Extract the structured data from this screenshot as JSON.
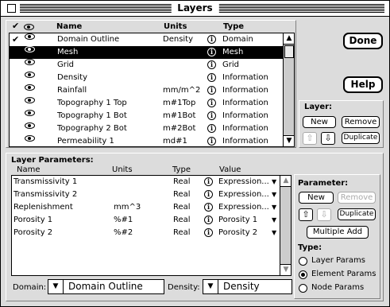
{
  "window": {
    "title": "Layers"
  },
  "layer_list": {
    "columns": {
      "check": "✔",
      "name": "Name",
      "units": "Units",
      "type": "Type"
    },
    "rows": [
      {
        "checked": true,
        "name": "Domain Outline",
        "units": "Density",
        "type": "Domain",
        "selected": false
      },
      {
        "checked": false,
        "name": "Mesh",
        "units": "",
        "type": "Mesh",
        "selected": true
      },
      {
        "checked": false,
        "name": "Grid",
        "units": "",
        "type": "Grid",
        "selected": false
      },
      {
        "checked": false,
        "name": "Density",
        "units": "",
        "type": "Information",
        "selected": false
      },
      {
        "checked": false,
        "name": "Rainfall",
        "units": "mm/m^2",
        "type": "Information",
        "selected": false
      },
      {
        "checked": false,
        "name": "Topography 1 Top",
        "units": "m#1Top",
        "type": "Information",
        "selected": false
      },
      {
        "checked": false,
        "name": "Topography 1 Bot",
        "units": "m#1Bot",
        "type": "Information",
        "selected": false
      },
      {
        "checked": false,
        "name": "Topography 2 Bot",
        "units": "m#2Bot",
        "type": "Information",
        "selected": false
      },
      {
        "checked": false,
        "name": "Permeability 1",
        "units": "md#1",
        "type": "Information",
        "selected": false
      }
    ]
  },
  "buttons": {
    "done": "Done",
    "help": "Help"
  },
  "layer_box": {
    "title": "Layer:",
    "new": "New",
    "remove": "Remove",
    "duplicate": "Duplicate"
  },
  "params": {
    "title": "Layer Parameters:",
    "columns": {
      "name": "Name",
      "units": "Units",
      "type": "Type",
      "value": "Value"
    },
    "rows": [
      {
        "name": "Transmissivity 1",
        "units": "",
        "type": "Real",
        "value": "Expression..."
      },
      {
        "name": "Transmissivity 2",
        "units": "",
        "type": "Real",
        "value": "Expression..."
      },
      {
        "name": "Replenishment",
        "units": "mm^3",
        "type": "Real",
        "value": "Expression..."
      },
      {
        "name": "Porosity 1",
        "units": "%#1",
        "type": "Real",
        "value": "Porosity 1"
      },
      {
        "name": "Porosity 2",
        "units": "%#2",
        "type": "Real",
        "value": "Porosity 2"
      }
    ],
    "domain_label": "Domain:",
    "domain_value": "Domain Outline",
    "density_label": "Density:",
    "density_value": "Density"
  },
  "parameter_box": {
    "title": "Parameter:",
    "new": "New",
    "remove": "Remove",
    "duplicate": "Duplicate",
    "multiple_add": "Multiple Add",
    "type_label": "Type:",
    "type_options": [
      "Layer Params",
      "Element Params",
      "Node Params"
    ],
    "selected_type": "Element Params"
  },
  "icons": {
    "info": "i",
    "eye": "eye-icon",
    "up": "⇧",
    "down": "⇩"
  }
}
